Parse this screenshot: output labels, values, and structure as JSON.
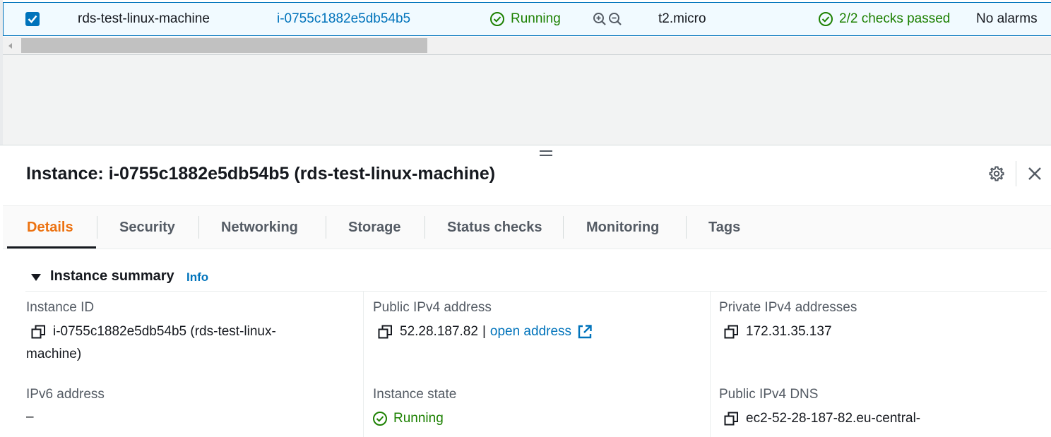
{
  "table_row": {
    "name": "rds-test-linux-machine",
    "instance_id": "i-0755c1882e5db54b5",
    "state": "Running",
    "instance_type": "t2.micro",
    "status_check": "2/2 checks passed",
    "alarms": "No alarms",
    "selected": true
  },
  "panel": {
    "title": "Instance: i-0755c1882e5db54b5 (rds-test-linux-machine)"
  },
  "tabs": [
    {
      "label": "Details",
      "active": true
    },
    {
      "label": "Security"
    },
    {
      "label": "Networking"
    },
    {
      "label": "Storage"
    },
    {
      "label": "Status checks"
    },
    {
      "label": "Monitoring"
    },
    {
      "label": "Tags"
    }
  ],
  "summary": {
    "title": "Instance summary",
    "info_label": "Info",
    "fields": {
      "instance_id_label": "Instance ID",
      "instance_id_value_line1": "i-0755c1882e5db54b5 (rds-test-linux-",
      "instance_id_value_line2": "machine)",
      "public_ipv4_label": "Public IPv4 address",
      "public_ipv4_value": "52.28.187.82",
      "public_ipv4_sep": "|",
      "open_address_label": "open address",
      "private_ipv4_label": "Private IPv4 addresses",
      "private_ipv4_value": "172.31.35.137",
      "ipv6_label": "IPv6 address",
      "ipv6_value": "–",
      "instance_state_label": "Instance state",
      "instance_state_value": "Running",
      "public_dns_label": "Public IPv4 DNS",
      "public_dns_value": "ec2-52-28-187-82.eu-central-"
    }
  },
  "colors": {
    "accent": "#0073bb",
    "success": "#1d8102",
    "active_tab": "#ec7211"
  }
}
